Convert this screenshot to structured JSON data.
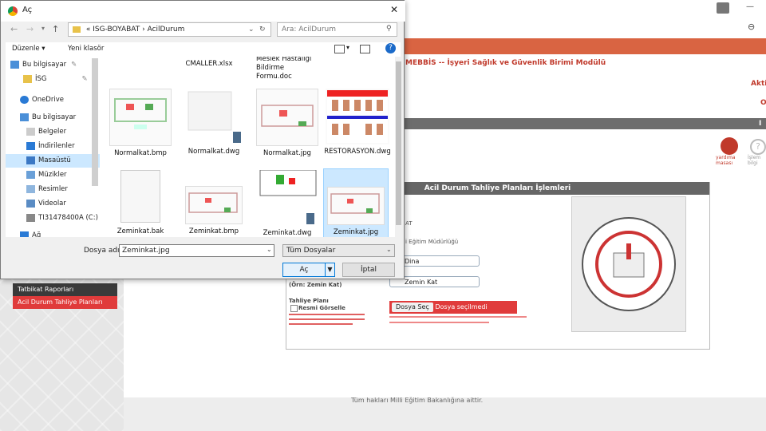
{
  "dialog": {
    "title": "Aç",
    "address": {
      "prefix": "«",
      "crumb1": "ISG-BOYABAT",
      "sep": "›",
      "crumb2": "AcilDurum"
    },
    "search_placeholder": "Ara: AcilDurum",
    "cmd": {
      "organize": "Düzenle ▾",
      "new_folder": "Yeni klasör"
    },
    "nav_items": [
      {
        "label": "Bu bilgisayar",
        "icon": "monitor-icon"
      },
      {
        "label": "İSG",
        "icon": "folder-icon"
      },
      {
        "label": "OneDrive",
        "icon": "cloud-icon"
      },
      {
        "label": "Bu bilgisayar",
        "icon": "monitor-icon"
      },
      {
        "label": "Belgeler",
        "icon": "document-icon"
      },
      {
        "label": "İndirilenler",
        "icon": "download-icon"
      },
      {
        "label": "Masaüstü",
        "icon": "desktop-icon"
      },
      {
        "label": "Müzikler",
        "icon": "music-icon"
      },
      {
        "label": "Resimler",
        "icon": "image-icon"
      },
      {
        "label": "Videolar",
        "icon": "video-icon"
      },
      {
        "label": "TI31478400A (C:)",
        "icon": "drive-icon"
      },
      {
        "label": "Ağ",
        "icon": "network-icon"
      }
    ],
    "files_top": [
      "",
      "CMALLER.xlsx",
      "Meslek Hastalığı Bildirme Formu.doc",
      ""
    ],
    "files": [
      {
        "name": "Normalkat.bmp",
        "kind": "plan"
      },
      {
        "name": "Normalkat.dwg",
        "kind": "plan-dwg"
      },
      {
        "name": "Normalkat.jpg",
        "kind": "plan"
      },
      {
        "name": "RESTORASYON.dwg",
        "kind": "facade"
      },
      {
        "name": "Zeminkat.bak",
        "kind": "blank"
      },
      {
        "name": "Zeminkat.bmp",
        "kind": "plan"
      },
      {
        "name": "Zeminkat.dwg",
        "kind": "plan-dwg"
      },
      {
        "name": "Zeminkat.jpg",
        "kind": "plan",
        "selected": true
      }
    ],
    "filename_label": "Dosya adı:",
    "filename_value": "Zeminkat.jpg",
    "filetype": "Tüm Dosyalar",
    "open_label": "Aç",
    "cancel_label": "İptal"
  },
  "page": {
    "module_title": "MEBBİS -- İşyeri Sağlık ve Güvenlik Birimi Modülü",
    "aktif": "Akti",
    "aktif2": "O",
    "gray_letter": "I",
    "form_title": "Acil Durum Tahliye Planları İşlemleri",
    "field1": "Dina",
    "field2": "Zemin Kat",
    "row_label1": "AT",
    "row_label2": "i Eğitim Müdürlüğü",
    "floor_label": "(Örn: Zemin Kat)",
    "plan_label": "Tahliye Planı",
    "official_label": "Resmi Görselle",
    "file_btn": "Dosya Seç",
    "file_status": "Dosya seçilmedi",
    "help_user": "yardıma masası",
    "help_link": "İşlem bilgi",
    "sidebar": [
      "Tatbikat Raporları",
      "Acil Durum Tahliye Planları"
    ],
    "footer": "Tüm hakları Milli Eğitim Bakanlığına aittir."
  },
  "colors": {
    "orange": "#d96442",
    "red": "#e03b3b",
    "selection": "#cce8ff"
  }
}
